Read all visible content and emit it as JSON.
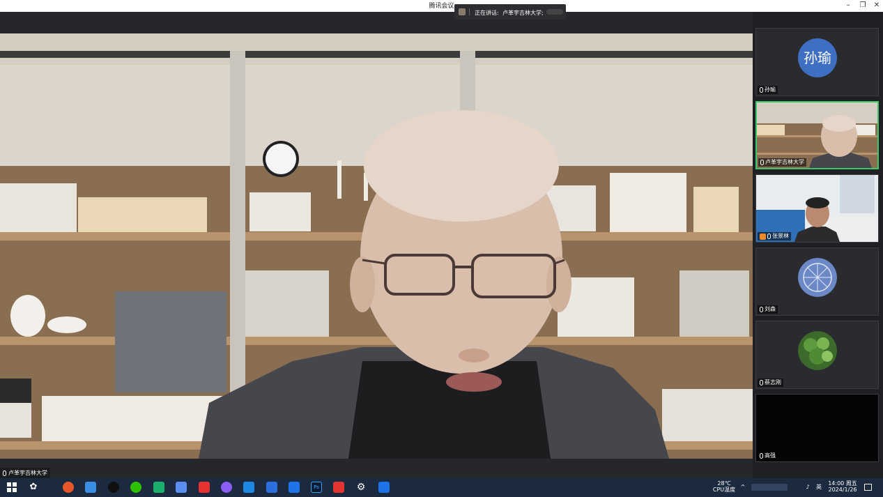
{
  "app": {
    "title": "腾讯会议"
  },
  "speaking": {
    "label": "正在讲话:",
    "name": "卢革宇吉林大学;"
  },
  "main": {
    "speaker_name": "卢革宇吉林大学"
  },
  "participants": [
    {
      "name": "孙瑜",
      "avatar_text": "孙瑜",
      "type": "avatar",
      "color": "#3f6fc2"
    },
    {
      "name": "卢革宇吉林大学",
      "type": "video",
      "active": true
    },
    {
      "name": "张景林",
      "type": "video"
    },
    {
      "name": "刘森",
      "type": "image"
    },
    {
      "name": "蔡志刚",
      "type": "image"
    },
    {
      "name": "高强",
      "type": "blank"
    }
  ],
  "taskbar": {
    "apps": [
      "start-icon",
      "widgets-icon",
      "firefox-icon",
      "browser-icon",
      "qq-icon",
      "wechat-icon",
      "app-icon",
      "baidu-icon",
      "xmind-icon",
      "app2-icon",
      "app3-icon",
      "box-icon",
      "feishu-icon",
      "photoshop-icon",
      "wps-icon",
      "settings-icon",
      "dingtalk-icon"
    ],
    "temp": "28℃",
    "temp_label": "CPU温度",
    "ime": "英",
    "time": "14:00 周五",
    "date": "2024/1/26"
  },
  "colors": {
    "active_border": "#3ec66b",
    "taskbar": "#1c2a3f"
  }
}
